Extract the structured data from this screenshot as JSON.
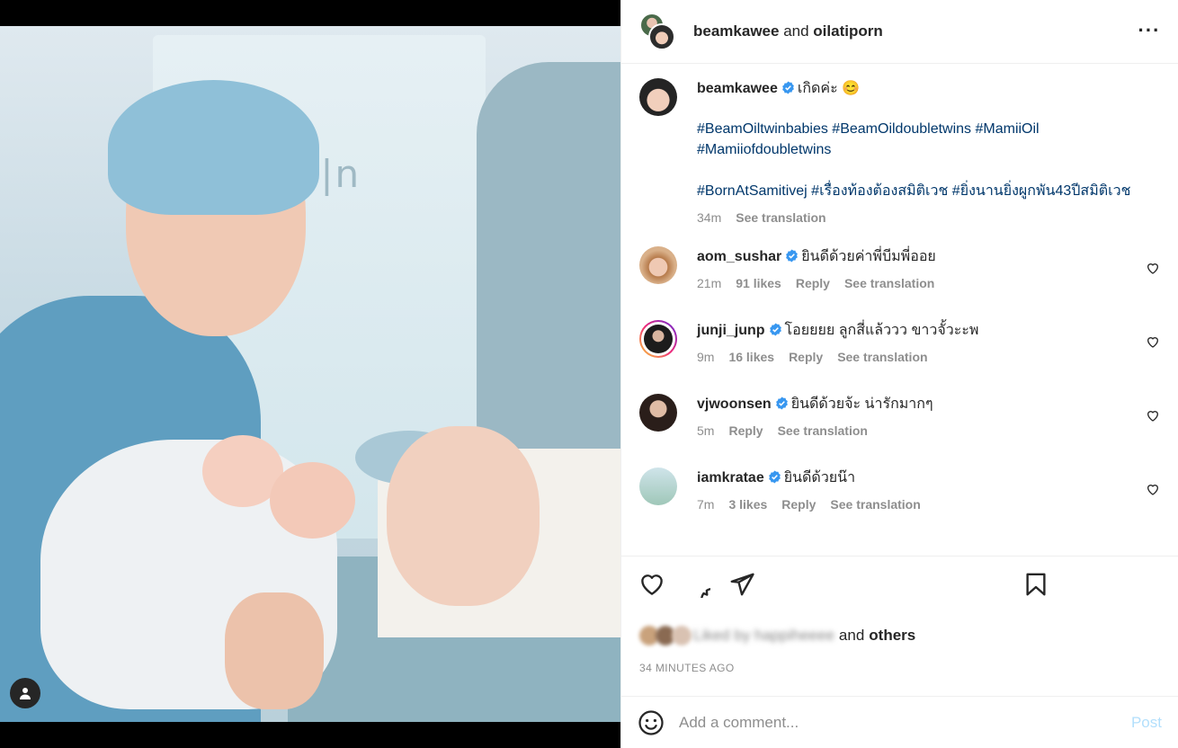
{
  "post": {
    "header": {
      "owner": "beamkawee",
      "connector": "and",
      "coauthor": "oilatiporn"
    },
    "caption": {
      "username": "beamkawee",
      "text": "เกิดค่ะ 😊",
      "hashtags_line1": "#BeamOiltwinbabies #BeamOildoubletwins #MamiiOil #Mamiiofdoubletwins",
      "hashtags_line2": "#BornAtSamitivej #เรื่องท้องต้องสมิติเวช #ยิ่งนานยิ่งผูกพัน43ปีสมิติเวช",
      "time": "34m",
      "translate": "See translation"
    },
    "comments": [
      {
        "username": "aom_sushar",
        "text": "ยินดีด้วยค่าพี่บีมพี่ออย",
        "time": "21m",
        "likes": "91 likes",
        "reply": "Reply",
        "translate": "See translation"
      },
      {
        "username": "junji_junp",
        "text": "โอยยยย ลูกสี่แล้ววว ขาวจั้วะะพ",
        "time": "9m",
        "likes": "16 likes",
        "reply": "Reply",
        "translate": "See translation"
      },
      {
        "username": "vjwoonsen",
        "text": "ยินดีด้วยจ้ะ น่ารักมากๆ",
        "time": "5m",
        "likes": "",
        "reply": "Reply",
        "translate": "See translation"
      },
      {
        "username": "iamkratae",
        "text": "ยินดีด้วยน๊า",
        "time": "7m",
        "likes": "3 likes",
        "reply": "Reply",
        "translate": "See translation"
      }
    ],
    "likes_summary": {
      "blurred": "Liked by happiheeee",
      "connector": "and",
      "others": "others"
    },
    "timestamp": "34 MINUTES AGO",
    "add_comment": {
      "placeholder": "Add a comment...",
      "post_label": "Post"
    },
    "icons": [
      "like-icon",
      "comment-icon",
      "share-icon",
      "save-icon",
      "emoji-icon",
      "more-icon",
      "user-tag-icon",
      "verified-icon",
      "heart-icon"
    ],
    "colors": {
      "hashtag": "#00376b",
      "verified": "#3897f0",
      "muted": "#8e8e8e",
      "post_disabled": "#b2dffc"
    }
  }
}
